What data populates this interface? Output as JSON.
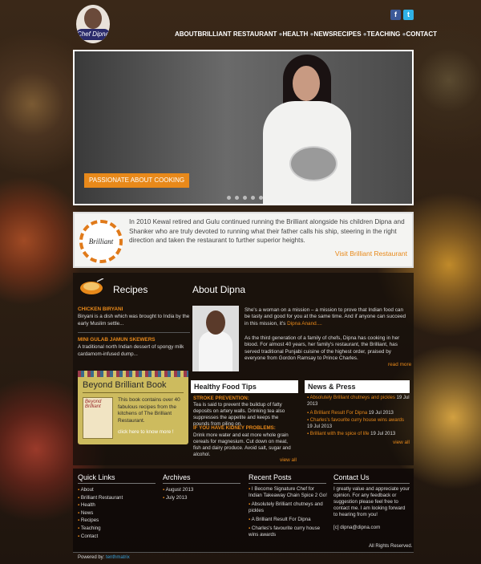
{
  "header": {
    "logo_text": "Chef Dipna",
    "social": {
      "facebook": "f",
      "twitter": "t"
    },
    "nav": [
      "ABOUT",
      "BRILLIANT RESTAURANT",
      "HEALTH",
      "NEWS",
      "RECIPES",
      "TEACHING",
      "CONTACT"
    ]
  },
  "slider": {
    "caption": "PASSIONATE ABOUT COOKING",
    "slides": 5
  },
  "intro": {
    "logo_text": "Brilliant",
    "text": "In 2010 Kewal retired and Gulu continued running the Brilliant alongside his children Dipna and Shanker who are truly devoted to running what their father calls his ship, steering in the right direction and taken the restaurant to further superior heights.",
    "link": "Visit Brilliant Restaurant"
  },
  "recipes": {
    "heading": "Recipes",
    "items": [
      {
        "title": "CHICKEN BIRYANI",
        "text": "Biryani is a dish which was brought to India by the early Muslim settle..."
      },
      {
        "title": "MINI GULAB JAMUN SKEWERS",
        "text": "A traditional north Indian dessert of spongy milk cardamom-infused dump..."
      }
    ]
  },
  "book": {
    "heading": "Beyond Brilliant Book",
    "cover_title": "Beyond Brilliant",
    "text": "This book contains over 40 fabulous recipes from the kitchens of The Brilliant Restaurant.",
    "button": "click here to know more !"
  },
  "about": {
    "heading": "About Dipna",
    "p1_a": "She's a woman on a mission – a mission to prove that Indian food can be tasty and good for you at the same time. And if anyone can succeed in this mission, it's ",
    "p1_b": "Dipna Anand....",
    "p2": "As the third generation of a family of chefs, Dipna has cooking in her blood. For almost 40 years, her family's restaurant, the Brilliant, has served traditional Punjabi cuisine of the highest order, praised by everyone from Gordon Ramsay to Prince Charles.",
    "read_more": "read more"
  },
  "healthy": {
    "heading": "Healthy Food Tips",
    "tips": [
      {
        "title": "STROKE PREVENTION:",
        "text": "Tea is said to prevent the buildup of fatty deposits on artery walls. Drinking tea also suppresses the appetite and keeps the pounds from piling on."
      },
      {
        "title": "IF YOU HAVE KIDNEY PROBLEMS:",
        "text": "Drink more water and eat more whole grain cereals for magnesium. Cut down on meat, fish and dairy produce. Avoid salt, sugar and alcohol."
      }
    ],
    "view_all": "view all"
  },
  "news": {
    "heading": "News & Press",
    "items": [
      {
        "title": "Absolutely Brilliant chutneys and pickles",
        "date": "19 Jul 2013"
      },
      {
        "title": "A Brilliant Result For Dipna",
        "date": "19 Jul 2013"
      },
      {
        "title": "Charles's favourite curry house wins awards",
        "date": "19 Jul 2013"
      },
      {
        "title": "Brilliant with the spice of life",
        "date": "19 Jul 2013"
      }
    ],
    "view_all": "view all"
  },
  "footer": {
    "quick_links": {
      "heading": "Quick Links",
      "items": [
        "About",
        "Brilliant Restaurant",
        "Health",
        "News",
        "Recipes",
        "Teaching",
        "Contact"
      ]
    },
    "archives": {
      "heading": "Archives",
      "items": [
        "August 2013",
        "July 2013"
      ]
    },
    "recent_posts": {
      "heading": "Recent Posts",
      "items": [
        "I Become Signature Chef for Indian Takeaway Chain Spice 2 Go!",
        "Absolutely Brilliant chutneys and pickles",
        "A Brilliant Result For Dipna",
        "Charles's favourite curry house wins awards"
      ]
    },
    "contact": {
      "heading": "Contact Us",
      "text": "I greatly value and appreciate your opinion. For any feedback or suggestion please feel free to contact me. I am looking forward to hearing from you!",
      "email": "[c] dipna@dipna.com"
    },
    "rights": "All Rights Reserved.",
    "powered_label": "Powered by:",
    "powered_brand": "tenthmatrix"
  },
  "colors": {
    "accent": "#e8891a",
    "book_bg": "#cdbb5e",
    "facebook": "#3b5998",
    "twitter": "#2fb1e6"
  }
}
